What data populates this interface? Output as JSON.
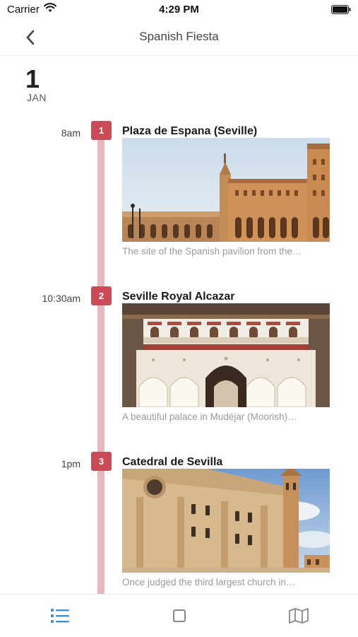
{
  "status_bar": {
    "carrier": "Carrier",
    "time": "4:29 PM",
    "wifi_icon": "wifi-icon",
    "battery_icon": "battery-icon"
  },
  "nav": {
    "title": "Spanish Fiesta",
    "back_icon": "chevron-left-icon"
  },
  "date": {
    "day": "1",
    "month": "JAN"
  },
  "colors": {
    "accent": "#cc4a55",
    "timeline": "#e9b8bf",
    "tab_active": "#3f8fd4",
    "tab_inactive": "#888888"
  },
  "entries": [
    {
      "time": "8am",
      "number": "1",
      "title": "Plaza de Espana (Seville)",
      "description": "The site of the Spanish pavilion from the…"
    },
    {
      "time": "10:30am",
      "number": "2",
      "title": "Seville Royal Alcazar",
      "description": "A beautiful palace in Mudéjar (Moorish)…"
    },
    {
      "time": "1pm",
      "number": "3",
      "title": "Catedral de Sevilla",
      "description": "Once judged the third largest church in…"
    }
  ],
  "tabs": [
    {
      "icon": "list-icon",
      "active": true
    },
    {
      "icon": "square-icon",
      "active": false
    },
    {
      "icon": "map-icon",
      "active": false
    }
  ]
}
